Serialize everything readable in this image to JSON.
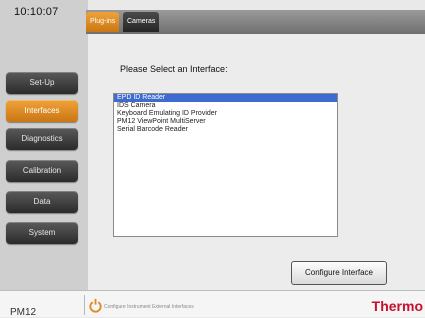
{
  "clock": "10:10:07",
  "nav": {
    "items": [
      {
        "label": "Set-Up",
        "active": false
      },
      {
        "label": "Interfaces",
        "active": true
      },
      {
        "label": "Diagnostics",
        "active": false
      },
      {
        "label": "Calibration",
        "active": false
      },
      {
        "label": "Data",
        "active": false
      },
      {
        "label": "System",
        "active": false
      }
    ]
  },
  "tabs": [
    {
      "label": "Plug-ins",
      "active": true
    },
    {
      "label": "Cameras",
      "active": false
    }
  ],
  "main": {
    "prompt": "Please Select an Interface:",
    "interfaces": [
      {
        "label": "EPD ID Reader",
        "selected": true
      },
      {
        "label": "IDS Camera",
        "selected": false
      },
      {
        "label": "Keyboard Emulating ID Provider",
        "selected": false
      },
      {
        "label": "PM12 ViewPoint MultiServer",
        "selected": false
      },
      {
        "label": "Serial Barcode Reader",
        "selected": false
      }
    ],
    "configure_label": "Configure Interface"
  },
  "footer": {
    "model": "PM12",
    "status_text": "Configure Instrument External Interfaces",
    "brand": "Thermo",
    "status_icon": "power-icon"
  },
  "colors": {
    "accent": "#e08a22",
    "selection": "#3f6bd0",
    "brand": "#c8102e"
  }
}
